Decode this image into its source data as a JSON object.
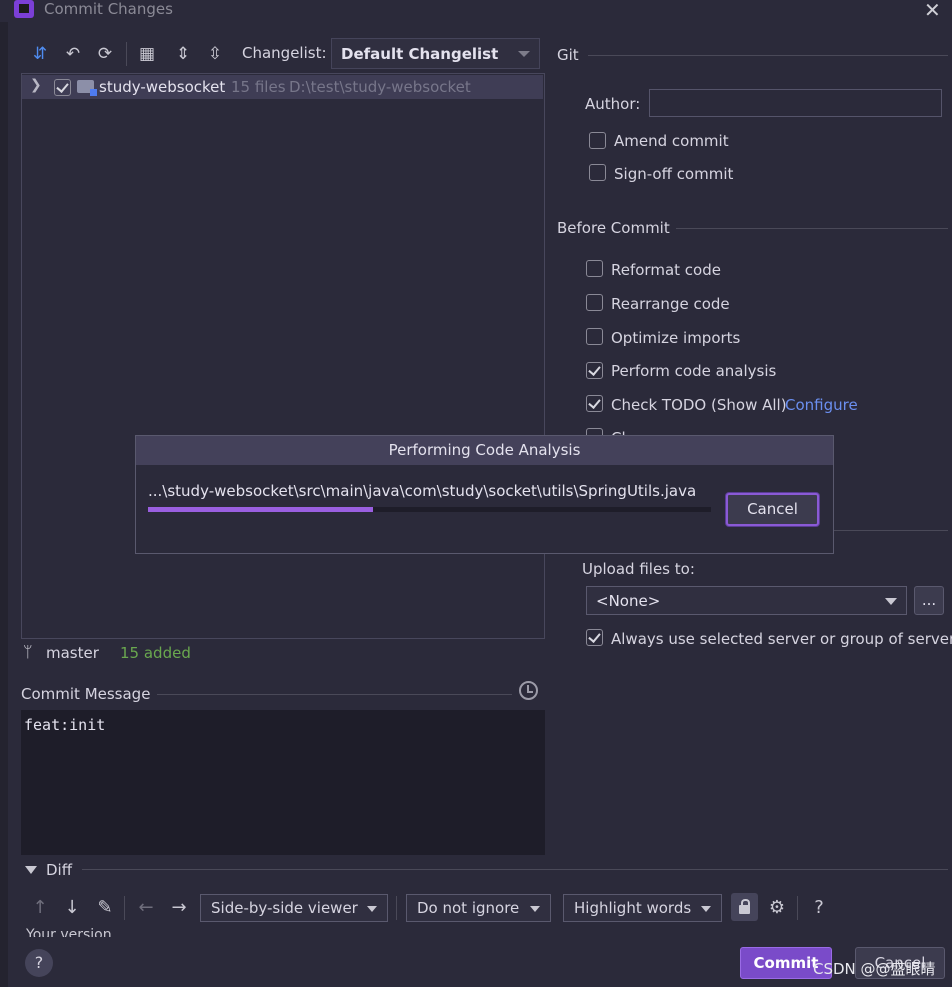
{
  "window": {
    "title": "Commit Changes"
  },
  "toolbar": {
    "changelist_label": "Changelist:",
    "changelist_value": "Default Changelist"
  },
  "tree": {
    "project_name": "study-websocket",
    "files_count": "15 files",
    "project_path": "D:\\test\\study-websocket"
  },
  "status": {
    "branch": "master",
    "added": "15 added"
  },
  "commit_message": {
    "label": "Commit Message",
    "value": "feat:init"
  },
  "git": {
    "section_label": "Git",
    "author_label": "Author:",
    "author_value": "",
    "amend_label": "Amend commit",
    "signoff_label": "Sign-off commit"
  },
  "before_commit": {
    "section_label": "Before Commit",
    "options": [
      {
        "label": "Reformat code",
        "checked": false
      },
      {
        "label": "Rearrange code",
        "checked": false
      },
      {
        "label": "Optimize imports",
        "checked": false
      },
      {
        "label": "Perform code analysis",
        "checked": true
      },
      {
        "label": "Check TODO (Show All)",
        "checked": true,
        "link": "Configure"
      },
      {
        "label": "Cl",
        "checked": false
      }
    ]
  },
  "upload": {
    "label": "Upload files to:",
    "value": "<None>",
    "more_button": "...",
    "always_use_label": "Always use selected server or group of servers"
  },
  "modal": {
    "title": "Performing Code Analysis",
    "path": "...\\study-websocket\\src\\main\\java\\com\\study\\socket\\utils\\SpringUtils.java",
    "progress": 0.4,
    "cancel_label": "Cancel"
  },
  "diff": {
    "label": "Diff",
    "viewer": "Side-by-side viewer",
    "ignore": "Do not ignore",
    "highlight": "Highlight words",
    "help": "?",
    "your_version": "Your version"
  },
  "footer": {
    "help": "?",
    "commit_label": "Commit",
    "cancel_label": "Cancel",
    "watermark": "CSDN @@盛眼睛"
  },
  "colors": {
    "accent": "#7a4bc9",
    "progress": "#9a5fe0",
    "link": "#6b8ff0",
    "added": "#6aa84f"
  }
}
